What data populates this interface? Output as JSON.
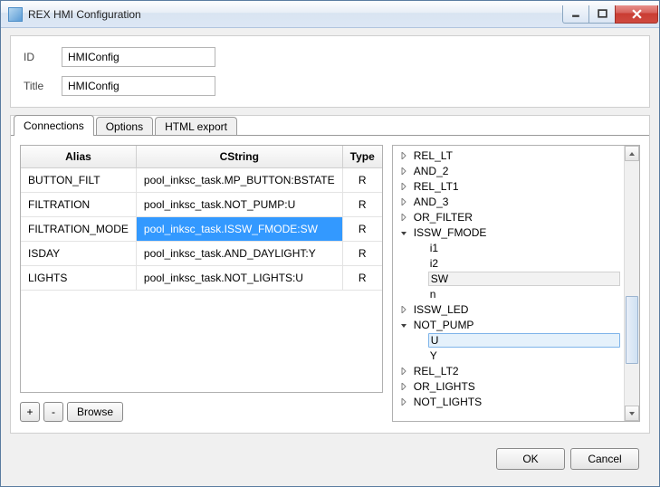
{
  "window": {
    "title": "REX HMI Configuration"
  },
  "form": {
    "id_label": "ID",
    "id_value": "HMIConfig",
    "title_label": "Title",
    "title_value": "HMIConfig"
  },
  "tabs": {
    "items": [
      "Connections",
      "Options",
      "HTML export"
    ],
    "active": 0
  },
  "grid": {
    "headers": {
      "alias": "Alias",
      "cstring": "CString",
      "type": "Type"
    },
    "rows": [
      {
        "alias": "BUTTON_FILT",
        "cstring": "pool_inksc_task.MP_BUTTON:BSTATE",
        "type": "R",
        "selected": false
      },
      {
        "alias": "FILTRATION",
        "cstring": "pool_inksc_task.NOT_PUMP:U",
        "type": "R",
        "selected": false
      },
      {
        "alias": "FILTRATION_MODE",
        "cstring": "pool_inksc_task.ISSW_FMODE:SW",
        "type": "R",
        "selected": true
      },
      {
        "alias": "ISDAY",
        "cstring": "pool_inksc_task.AND_DAYLIGHT:Y",
        "type": "R",
        "selected": false
      },
      {
        "alias": "LIGHTS",
        "cstring": "pool_inksc_task.NOT_LIGHTS:U",
        "type": "R",
        "selected": false
      }
    ]
  },
  "buttons": {
    "add": "+",
    "remove": "-",
    "browse": "Browse"
  },
  "tree": [
    {
      "label": "REL_LT",
      "depth": 1,
      "expand": "closed"
    },
    {
      "label": "AND_2",
      "depth": 1,
      "expand": "closed"
    },
    {
      "label": "REL_LT1",
      "depth": 1,
      "expand": "closed"
    },
    {
      "label": "AND_3",
      "depth": 1,
      "expand": "closed"
    },
    {
      "label": "OR_FILTER",
      "depth": 1,
      "expand": "closed"
    },
    {
      "label": "ISSW_FMODE",
      "depth": 1,
      "expand": "open"
    },
    {
      "label": "i1",
      "depth": 2,
      "expand": "none"
    },
    {
      "label": "i2",
      "depth": 2,
      "expand": "none"
    },
    {
      "label": "SW",
      "depth": 2,
      "expand": "none",
      "state": "hover"
    },
    {
      "label": "n",
      "depth": 2,
      "expand": "none"
    },
    {
      "label": "ISSW_LED",
      "depth": 1,
      "expand": "closed"
    },
    {
      "label": "NOT_PUMP",
      "depth": 1,
      "expand": "open"
    },
    {
      "label": "U",
      "depth": 2,
      "expand": "none",
      "state": "sel"
    },
    {
      "label": "Y",
      "depth": 2,
      "expand": "none"
    },
    {
      "label": "REL_LT2",
      "depth": 1,
      "expand": "closed"
    },
    {
      "label": "OR_LIGHTS",
      "depth": 1,
      "expand": "closed"
    },
    {
      "label": "NOT_LIGHTS",
      "depth": 1,
      "expand": "closed"
    }
  ],
  "footer": {
    "ok": "OK",
    "cancel": "Cancel"
  }
}
